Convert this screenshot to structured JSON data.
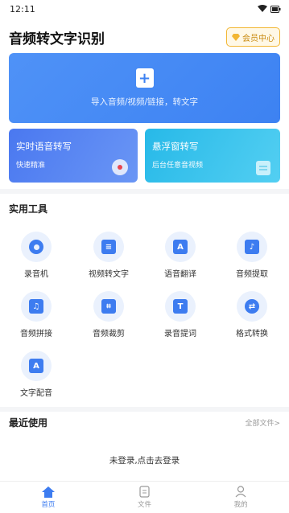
{
  "status_bar": {
    "time": "12:11"
  },
  "header": {
    "title": "音频转文字识别",
    "vip_label": "会员中心"
  },
  "import_card": {
    "label": "导入音频/视频/链接，转文字"
  },
  "features": [
    {
      "title": "实时语音转写",
      "subtitle": "快速精准"
    },
    {
      "title": "悬浮窗转写",
      "subtitle": "后台任意音视频"
    }
  ],
  "tools": {
    "title": "实用工具",
    "items": [
      {
        "label": "录音机",
        "icon": "recorder-icon"
      },
      {
        "label": "视频转文字",
        "icon": "video-to-text-icon"
      },
      {
        "label": "语音翻译",
        "icon": "translate-icon"
      },
      {
        "label": "音频提取",
        "icon": "audio-extract-icon"
      },
      {
        "label": "音频拼接",
        "icon": "audio-merge-icon"
      },
      {
        "label": "音频裁剪",
        "icon": "audio-crop-icon"
      },
      {
        "label": "录音提词",
        "icon": "teleprompter-icon"
      },
      {
        "label": "格式转换",
        "icon": "format-convert-icon"
      },
      {
        "label": "文字配音",
        "icon": "text-to-speech-icon"
      }
    ]
  },
  "recent": {
    "title": "最近使用",
    "all_files": "全部文件>",
    "empty_tip": "未登录,点击去登录"
  },
  "bottom_nav": [
    {
      "label": "首页",
      "icon": "home-icon",
      "active": true
    },
    {
      "label": "文件",
      "icon": "file-icon",
      "active": false
    },
    {
      "label": "我的",
      "icon": "profile-icon",
      "active": false
    }
  ],
  "colors": {
    "accent": "#3d7cf0",
    "vip": "#f2b632",
    "record": "#e84650"
  }
}
